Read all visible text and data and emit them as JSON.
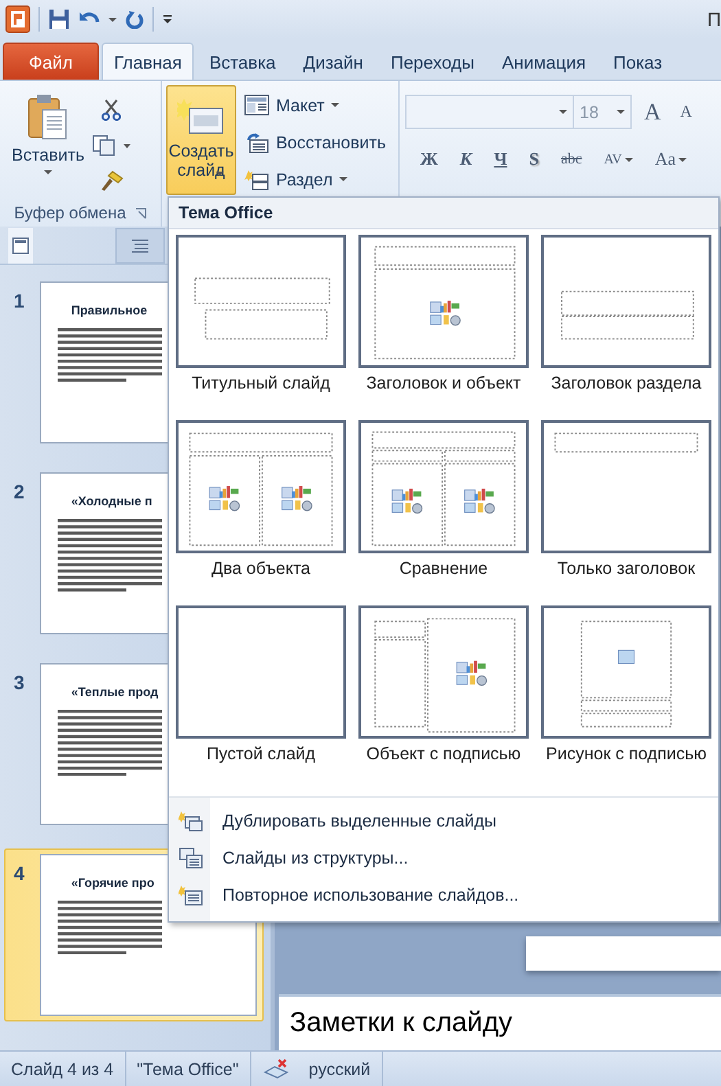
{
  "window": {
    "title": "П"
  },
  "tabs": [
    {
      "label": "Файл",
      "kind": "file",
      "selected": false
    },
    {
      "label": "Главная",
      "kind": "tab",
      "selected": true
    },
    {
      "label": "Вставка",
      "kind": "tab",
      "selected": false
    },
    {
      "label": "Дизайн",
      "kind": "tab",
      "selected": false
    },
    {
      "label": "Переходы",
      "kind": "tab",
      "selected": false
    },
    {
      "label": "Анимация",
      "kind": "tab",
      "selected": false
    },
    {
      "label": "Показ",
      "kind": "tab",
      "selected": false
    }
  ],
  "ribbon": {
    "clipboard": {
      "paste_label": "Вставить",
      "group_label": "Буфер обмена"
    },
    "slides": {
      "new_slide": {
        "label": "Создать слайд",
        "pressed": true
      },
      "commands": [
        {
          "label": "Макет",
          "kind": "layout",
          "dropdown": true
        },
        {
          "label": "Восстановить",
          "kind": "reset",
          "dropdown": false
        },
        {
          "label": "Раздел",
          "kind": "section",
          "dropdown": true
        }
      ]
    },
    "font": {
      "font_size": "18",
      "size_buttons": [
        {
          "label": "A",
          "kind": "grow"
        },
        {
          "label": "A",
          "kind": "shrink"
        }
      ],
      "format_buttons": [
        {
          "label": "Ж",
          "kind": "bold",
          "dropdown": false
        },
        {
          "label": "К",
          "kind": "italic",
          "dropdown": false
        },
        {
          "label": "Ч",
          "kind": "underline",
          "dropdown": false
        },
        {
          "label": "S",
          "kind": "shadow",
          "dropdown": false
        },
        {
          "label": "abc",
          "kind": "strike",
          "dropdown": false
        },
        {
          "label": "AV",
          "kind": "spacing",
          "dropdown": true
        },
        {
          "label": "Aa",
          "kind": "case",
          "dropdown": true
        }
      ]
    }
  },
  "slide_pane": {
    "tabs": [
      {
        "kind": "slides",
        "selected": true
      },
      {
        "kind": "outline",
        "selected": false
      }
    ],
    "slides": [
      {
        "number": "1",
        "title": "Правильное",
        "selected": false
      },
      {
        "number": "2",
        "title": "«Холодные п",
        "selected": false
      },
      {
        "number": "3",
        "title": "«Теплые прод",
        "selected": false
      },
      {
        "number": "4",
        "title": "«Горячие про",
        "selected": true
      }
    ]
  },
  "notes": {
    "placeholder": "Заметки к слайду"
  },
  "status_bar": {
    "slide_info": "Слайд 4 из 4",
    "theme": "\"Тема Office\"",
    "language": "русский"
  },
  "new_slide_menu": {
    "header": "Тема Office",
    "layouts": [
      {
        "label": "Титульный слайд",
        "kind": "title"
      },
      {
        "label": "Заголовок и объект",
        "kind": "title_content"
      },
      {
        "label": "Заголовок раздела",
        "kind": "section"
      },
      {
        "label": "Два объекта",
        "kind": "two_content"
      },
      {
        "label": "Сравнение",
        "kind": "comparison"
      },
      {
        "label": "Только заголовок",
        "kind": "title_only"
      },
      {
        "label": "Пустой слайд",
        "kind": "blank"
      },
      {
        "label": "Объект с подписью",
        "kind": "content_caption"
      },
      {
        "label": "Рисунок с подписью",
        "kind": "picture_caption"
      }
    ],
    "items": [
      {
        "label": "Дублировать выделенные слайды",
        "kind": "duplicate"
      },
      {
        "label": "Слайды из структуры...",
        "kind": "outline"
      },
      {
        "label": "Повторное использование слайдов...",
        "kind": "reuse"
      }
    ]
  }
}
